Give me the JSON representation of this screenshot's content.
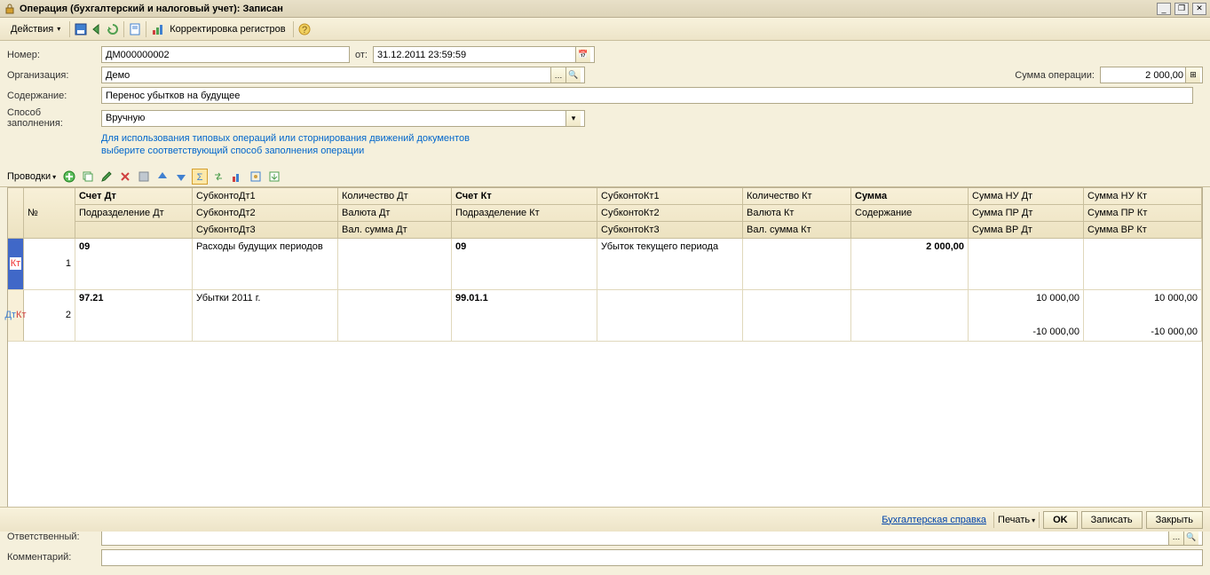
{
  "title": "Операция (бухгалтерский и налоговый учет): Записан",
  "toolbar": {
    "actions": "Действия",
    "reg_correct": "Корректировка регистров"
  },
  "form": {
    "number_label": "Номер:",
    "number_value": "ДМ000000002",
    "from_label": "от:",
    "from_value": "31.12.2011 23:59:59",
    "org_label": "Организация:",
    "org_value": "Демо",
    "sum_label": "Сумма операции:",
    "sum_value": "2 000,00",
    "content_label": "Содержание:",
    "content_value": "Перенос убытков на будущее",
    "fill_label": "Способ заполнения:",
    "fill_value": "Вручную",
    "hint1": "Для использования типовых операций или сторнирования движений документов",
    "hint2": "выберите соответствующий способ заполнения операции"
  },
  "entries": {
    "tab_label": "Проводки"
  },
  "grid": {
    "headers": {
      "num": "№",
      "acc_dt": "Счет Дт",
      "subdiv_dt": "Подразделение Дт",
      "subconto_dt1": "СубконтоДт1",
      "subconto_dt2": "СубконтоДт2",
      "subconto_dt3": "СубконтоДт3",
      "qty_dt": "Количество Дт",
      "curr_dt": "Валюта Дт",
      "curr_sum_dt": "Вал. сумма Дт",
      "acc_kt": "Счет Кт",
      "subdiv_kt": "Подразделение Кт",
      "subconto_kt1": "СубконтоКт1",
      "subconto_kt2": "СубконтоКт2",
      "subconto_kt3": "СубконтоКт3",
      "qty_kt": "Количество Кт",
      "curr_kt": "Валюта Кт",
      "curr_sum_kt": "Вал. сумма Кт",
      "sum": "Сумма",
      "content": "Содержание",
      "sum_nu_dt": "Сумма НУ Дт",
      "sum_pr_dt": "Сумма ПР Дт",
      "sum_vr_dt": "Сумма ВР Дт",
      "sum_nu_kt": "Сумма НУ Кт",
      "sum_pr_kt": "Сумма ПР Кт",
      "sum_vr_kt": "Сумма ВР Кт"
    },
    "rows": [
      {
        "marker": "Кт",
        "num": "1",
        "acc_dt": "09",
        "subconto_dt1": "Расходы будущих периодов",
        "acc_kt": "09",
        "subconto_kt1": "Убыток текущего периода",
        "sum": "2 000,00"
      },
      {
        "marker": "Дт Кт",
        "num": "2",
        "acc_dt": "97.21",
        "subconto_dt1": "Убытки 2011 г.",
        "acc_kt": "99.01.1",
        "sum_nu_dt": "10 000,00",
        "sum_nu_kt": "10 000,00",
        "sum_vr_dt": "-10 000,00",
        "sum_vr_kt": "-10 000,00"
      }
    ]
  },
  "footer": {
    "resp_label": "Ответственный:",
    "comment_label": "Комментарий:"
  },
  "bottom": {
    "ref": "Бухгалтерская справка",
    "print": "Печать",
    "ok": "OK",
    "save": "Записать",
    "close": "Закрыть"
  }
}
